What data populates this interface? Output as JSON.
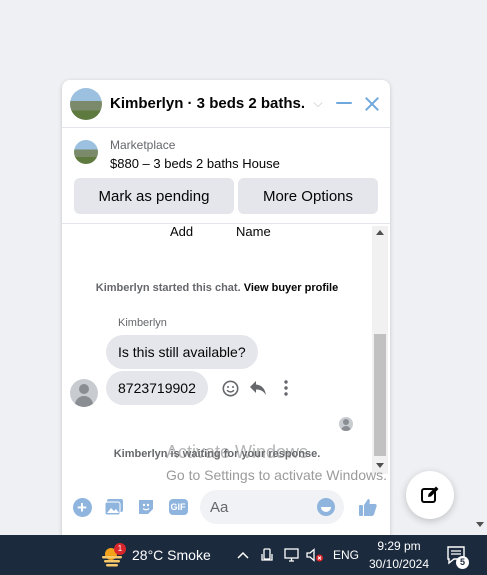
{
  "header": {
    "title": "Kimberlyn · 3 beds 2 baths..."
  },
  "marketplace": {
    "source": "Marketplace",
    "listing": "$880 – 3 beds 2 baths House",
    "pending_label": "Mark as pending",
    "more_label": "More Options"
  },
  "conversation": {
    "add_label": "Add",
    "name_label": "Name",
    "started_text": "Kimberlyn started this chat.",
    "view_profile_label": "View buyer profile",
    "sender_name": "Kimberlyn",
    "messages": [
      "Is this still available?",
      "8723719902"
    ],
    "waiting_text": "Kimberlyn is waiting for your response."
  },
  "composer": {
    "placeholder": "Aa"
  },
  "watermark": {
    "line1": "Activate Windows",
    "line2": "Go to Settings to activate Windows."
  },
  "taskbar": {
    "weather_badge": "1",
    "weather": "28°C  Smoke",
    "language": "ENG",
    "time": "9:29 pm",
    "date": "30/10/2024",
    "notification_count": "5"
  },
  "colors": {
    "accent": "#6fa8dc",
    "bubble": "#e4e6eb",
    "taskbar": "#1b2a3d",
    "badge": "#d9262b"
  },
  "icons": [
    "chevron-down-icon",
    "minimize-icon",
    "close-icon",
    "emoji-react-icon",
    "reply-icon",
    "more-icon",
    "plus-icon",
    "photo-icon",
    "sticker-icon",
    "gif-icon",
    "emoji-icon",
    "thumbs-up-icon",
    "compose-icon",
    "weather-icon",
    "chevron-up-icon",
    "network-icon",
    "volume-muted-icon",
    "notifications-icon"
  ]
}
